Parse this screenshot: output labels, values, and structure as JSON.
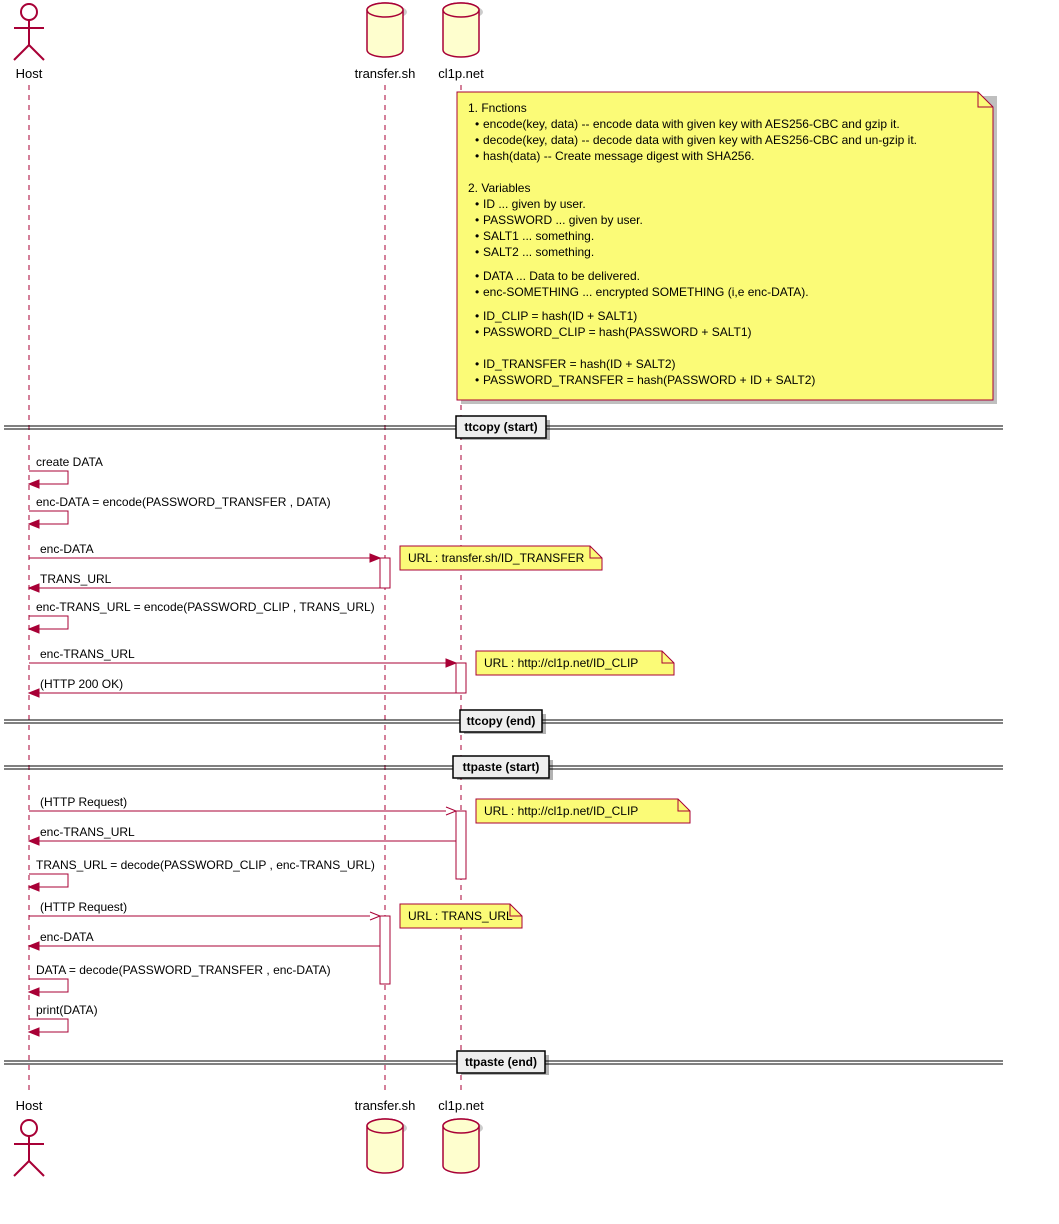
{
  "participants": {
    "host": "Host",
    "transfer": "transfer.sh",
    "cl1p": "cl1p.net"
  },
  "note": {
    "l1": "1. Fnctions",
    "l2": "encode(key, data) -- encode data with given key with AES256-CBC and gzip it.",
    "l3": "decode(key, data) -- decode data with given key with AES256-CBC and un-gzip it.",
    "l4": "hash(data) -- Create message digest with SHA256.",
    "l5": "2. Variables",
    "l6": "ID ... given by user.",
    "l7": "PASSWORD ... given by user.",
    "l8": "SALT1 ... something.",
    "l9": "SALT2 ... something.",
    "l10": "DATA ... Data to be delivered.",
    "l11": "enc-SOMETHING ... encrypted SOMETHING (i,e enc-DATA).",
    "l12": "ID_CLIP = hash(ID + SALT1)",
    "l13": "PASSWORD_CLIP = hash(PASSWORD + SALT1)",
    "l14": "ID_TRANSFER = hash(ID + SALT2)",
    "l15": "PASSWORD_TRANSFER = hash(PASSWORD + ID + SALT2)"
  },
  "dividers": {
    "d1": "ttcopy (start)",
    "d2": "ttcopy (end)",
    "d3": "ttpaste (start)",
    "d4": "ttpaste (end)"
  },
  "messages": {
    "m1": "create DATA",
    "m2": "enc-DATA = encode(PASSWORD_TRANSFER , DATA)",
    "m3": "enc-DATA",
    "m4": "TRANS_URL",
    "m5": "enc-TRANS_URL = encode(PASSWORD_CLIP , TRANS_URL)",
    "m6": "enc-TRANS_URL",
    "m7": "(HTTP 200 OK)",
    "m8": "(HTTP Request)",
    "m9": "enc-TRANS_URL",
    "m10": "TRANS_URL = decode(PASSWORD_CLIP , enc-TRANS_URL)",
    "m11": "(HTTP Request)",
    "m12": "enc-DATA",
    "m13": "DATA = decode(PASSWORD_TRANSFER , enc-DATA)",
    "m14": "print(DATA)"
  },
  "small_notes": {
    "n1": "URL : transfer.sh/ID_TRANSFER",
    "n2": "URL : http://cl1p.net/ID_CLIP",
    "n3": "URL : http://cl1p.net/ID_CLIP",
    "n4": "URL : TRANS_URL"
  }
}
